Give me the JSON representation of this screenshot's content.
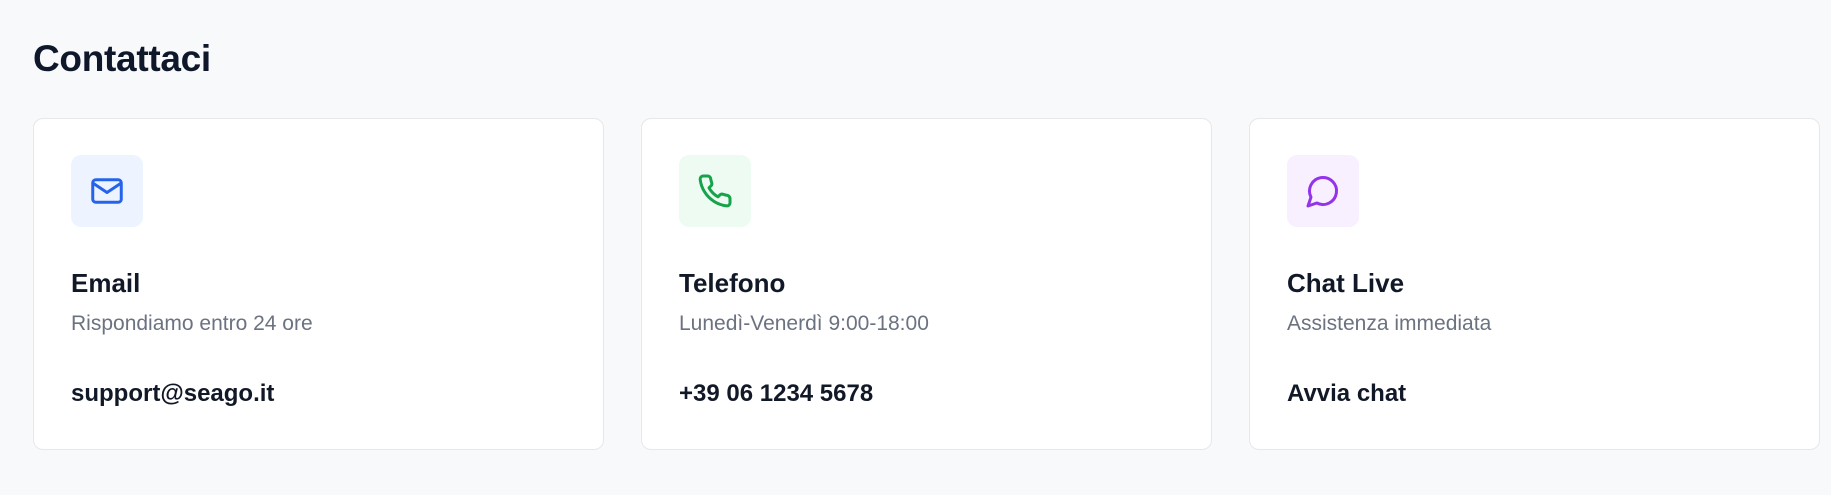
{
  "page": {
    "title": "Contattaci"
  },
  "cards": [
    {
      "icon": "mail-icon",
      "icon_color": "#2563eb",
      "icon_bg": "#eef4ff",
      "title": "Email",
      "subtitle": "Rispondiamo entro 24 ore",
      "value": "support@seago.it"
    },
    {
      "icon": "phone-icon",
      "icon_color": "#16a34a",
      "icon_bg": "#eefbf2",
      "title": "Telefono",
      "subtitle": "Lunedì-Venerdì 9:00-18:00",
      "value": "+39 06 1234 5678"
    },
    {
      "icon": "chat-bubble-icon",
      "icon_color": "#9333ea",
      "icon_bg": "#f8f0ff",
      "title": "Chat Live",
      "subtitle": "Assistenza immediata",
      "value": "Avvia chat"
    }
  ]
}
